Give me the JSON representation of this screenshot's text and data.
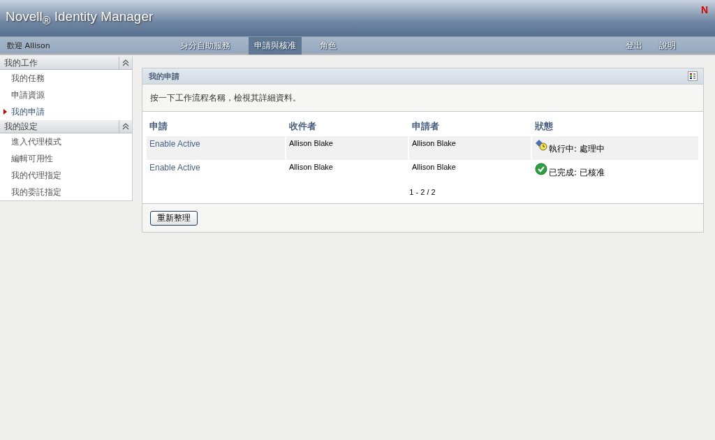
{
  "header": {
    "title": "Novell$_{®}$ Identity Manager",
    "logo_letter": "N"
  },
  "navbar": {
    "welcome": "歡迎 Allison",
    "tabs": [
      {
        "label": "身分自助服務",
        "selected": false
      },
      {
        "label": "申請與核准",
        "selected": true
      },
      {
        "label": "角色",
        "selected": false
      }
    ],
    "links": [
      "登出",
      "說明"
    ]
  },
  "sidebar": {
    "sections": [
      {
        "title": "我的工作",
        "items": [
          {
            "label": "我的任務",
            "selected": false
          },
          {
            "label": "申請資源",
            "selected": false
          },
          {
            "label": "我的申請",
            "selected": true
          }
        ]
      },
      {
        "title": "我的設定",
        "items": [
          {
            "label": "進入代理模式",
            "selected": false
          },
          {
            "label": "編輯可用性",
            "selected": false
          },
          {
            "label": "我的代理指定",
            "selected": false
          },
          {
            "label": "我的委託指定",
            "selected": false
          }
        ]
      }
    ]
  },
  "panel": {
    "title": "我的申請",
    "instruction": "按一下工作流程名稱，檢視其詳細資料。",
    "table": {
      "columns": [
        "申請",
        "收件者",
        "申請者",
        "狀態"
      ],
      "rows": [
        {
          "request": "Enable Active",
          "recipient": "Allison Blake",
          "requester": "Allison Blake",
          "status": "執行中: 處理中",
          "kind": "running"
        },
        {
          "request": "Enable Active",
          "recipient": "Allison Blake",
          "requester": "Allison Blake",
          "status": "已完成: 已核准",
          "kind": "approved"
        }
      ]
    },
    "pagination": "1 - 2 / 2",
    "refresh_button": "重新整理"
  }
}
